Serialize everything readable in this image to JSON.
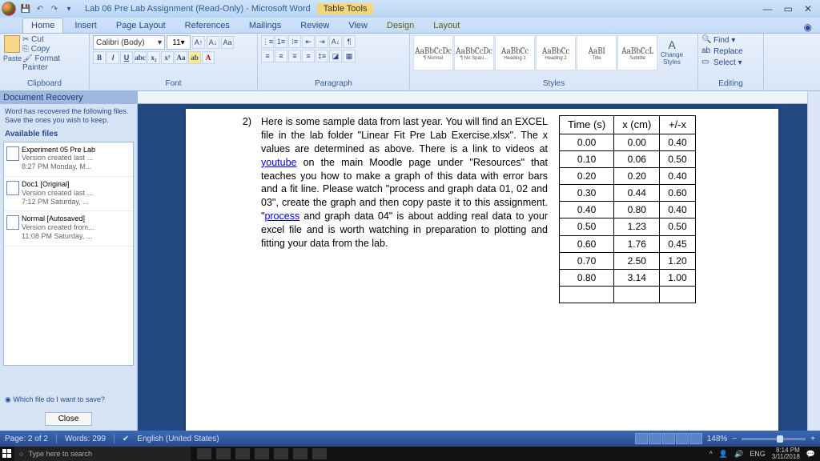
{
  "title": {
    "doc": "Lab 06 Pre Lab Assignment (Read-Only) - Microsoft Word",
    "context_tools": "Table Tools"
  },
  "qat": {
    "save": "💾",
    "undo": "↶",
    "redo": "↷"
  },
  "tabs": {
    "home": "Home",
    "insert": "Insert",
    "pagelayout": "Page Layout",
    "references": "References",
    "mailings": "Mailings",
    "review": "Review",
    "view": "View",
    "design": "Design",
    "layout": "Layout"
  },
  "ribbon": {
    "clipboard": {
      "paste": "Paste",
      "cut": "Cut",
      "copy": "Copy",
      "format_painter": "Format Painter",
      "label": "Clipboard"
    },
    "font": {
      "name": "Calibri (Body)",
      "size": "11",
      "label": "Font"
    },
    "paragraph": {
      "label": "Paragraph"
    },
    "styles": {
      "items": [
        {
          "prev": "AaBbCcDc",
          "name": "¶ Normal"
        },
        {
          "prev": "AaBbCcDc",
          "name": "¶ No Spaci..."
        },
        {
          "prev": "AaBbCc",
          "name": "Heading 1"
        },
        {
          "prev": "AaBbCc",
          "name": "Heading 2"
        },
        {
          "prev": "AaBl",
          "name": "Title"
        },
        {
          "prev": "AaBbCcL",
          "name": "Subtitle"
        }
      ],
      "change": "Change Styles",
      "label": "Styles"
    },
    "editing": {
      "find": "Find ▾",
      "replace": "Replace",
      "select": "Select ▾",
      "label": "Editing"
    }
  },
  "recovery": {
    "title": "Document Recovery",
    "msg": "Word has recovered the following files. Save the ones you wish to keep.",
    "avail": "Available files",
    "files": [
      {
        "fn": "Experiment 05 Pre Lab",
        "l2": "Version created last ...",
        "l3": "8:27 PM Monday, M..."
      },
      {
        "fn": "Doc1 [Original]",
        "l2": "Version created last ...",
        "l3": "7:12 PM Saturday, ..."
      },
      {
        "fn": "Normal [Autosaved]",
        "l2": "Version created from...",
        "l3": "11:08 PM Saturday, ..."
      }
    ],
    "which": "Which file do I want to save?",
    "close": "Close"
  },
  "doc": {
    "num": "2)",
    "text_pre": "Here is some sample data from last year. You will find an EXCEL file in the lab folder \"Linear Fit Pre Lab Exercise.xlsx\". The x values are determined as above. There is a link to videos at ",
    "link1": "youtube",
    "text_mid": " on the main Moodle page under \"Resources\" that teaches you how to make a graph of this data with error bars and a fit line. Please watch \"process and graph data 01, 02 and 03\", create the graph and then copy paste it to this assignment. \"",
    "link2": "process",
    "text_post": " and graph data 04\" is about adding real data to your excel file and is worth watching in preparation to plotting and fitting your data from the lab.",
    "table": {
      "h1": "Time (s)",
      "h2": "x (cm)",
      "h3": "+/-x",
      "rows": [
        [
          "0.00",
          "0.00",
          "0.40"
        ],
        [
          "0.10",
          "0.06",
          "0.50"
        ],
        [
          "0.20",
          "0.20",
          "0.40"
        ],
        [
          "0.30",
          "0.44",
          "0.60"
        ],
        [
          "0.40",
          "0.80",
          "0.40"
        ],
        [
          "0.50",
          "1.23",
          "0.50"
        ],
        [
          "0.60",
          "1.76",
          "0.45"
        ],
        [
          "0.70",
          "2.50",
          "1.20"
        ],
        [
          "0.80",
          "3.14",
          "1.00"
        ]
      ]
    }
  },
  "status": {
    "page": "Page: 2 of 2",
    "words": "Words: 299",
    "lang": "English (United States)",
    "zoom": "148%"
  },
  "taskbar": {
    "search": "Type here to search",
    "lang": "ENG",
    "time": "8:14 PM",
    "date": "3/11/2018"
  }
}
